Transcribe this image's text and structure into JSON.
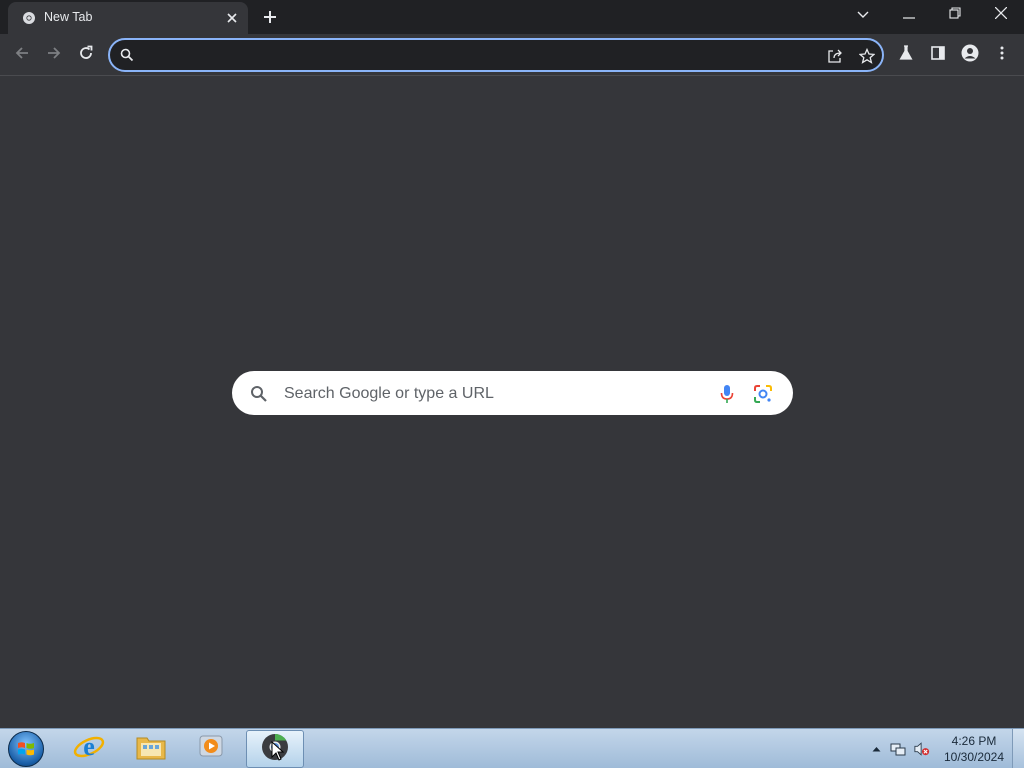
{
  "browser": {
    "tab": {
      "title": "New Tab",
      "favicon": "chrome-icon"
    },
    "window_controls": [
      "tab-search-icon",
      "minimize-icon",
      "restore-icon",
      "close-icon"
    ],
    "toolbar": {
      "omnibox": {
        "value": "",
        "placeholder": ""
      },
      "icons": [
        "back-icon",
        "forward-icon",
        "reload-icon",
        "share-icon",
        "bookmark-star-icon",
        "labs-icon",
        "side-panel-icon",
        "profile-icon",
        "menu-icon"
      ]
    }
  },
  "ntp": {
    "search": {
      "placeholder": "Search Google or type a URL",
      "value": ""
    }
  },
  "taskbar": {
    "items": [
      "start-orb",
      "internet-explorer-icon",
      "file-explorer-icon",
      "media-player-icon",
      "chrome-icon"
    ],
    "tray": [
      "show-hidden-icons",
      "network-icon",
      "volume-muted-icon"
    ],
    "clock": {
      "time": "4:26 PM",
      "date": "10/30/2024"
    }
  },
  "colors": {
    "tab_strip": "#202124",
    "toolbar": "#35363a",
    "page_background": "#35363a",
    "omnibox_focus": "#8ab4f8",
    "search_box": "#ffffff"
  }
}
